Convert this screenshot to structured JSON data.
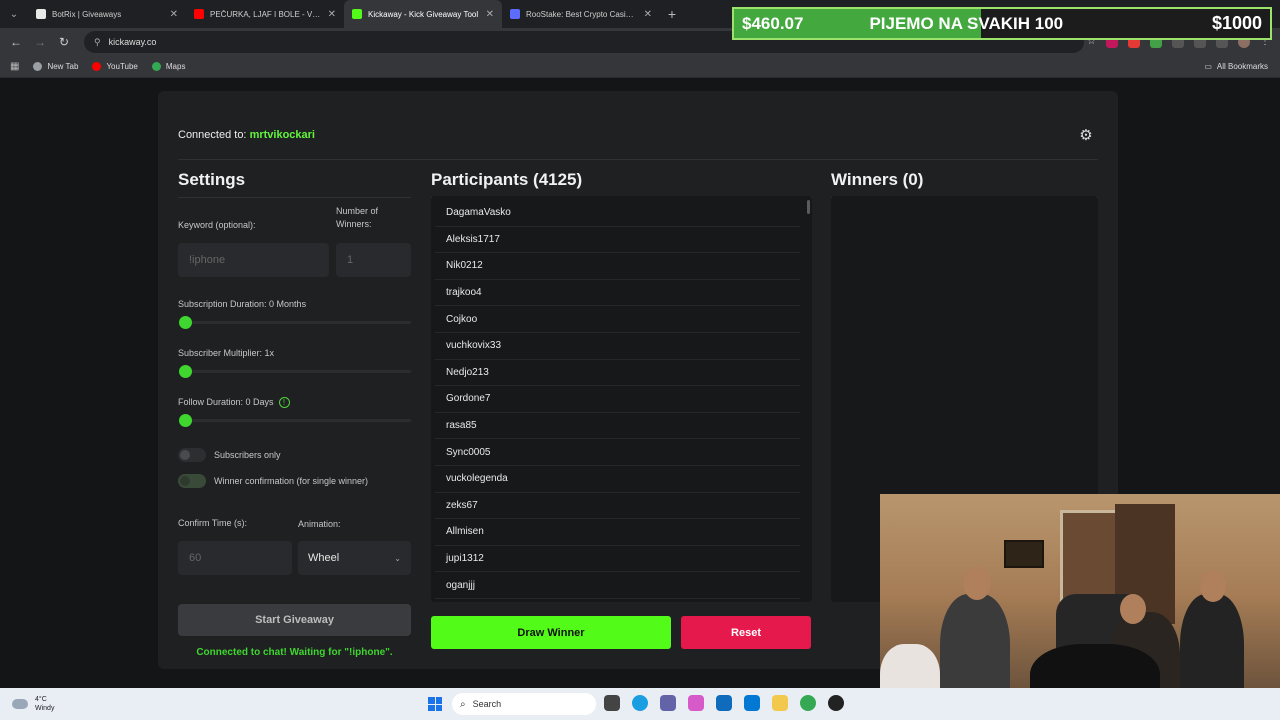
{
  "browser": {
    "tabs": [
      {
        "label": "BotRix | Giveaways",
        "color": "#e8e8e8",
        "active": false
      },
      {
        "label": "PEČURKA, LJAF I BOLE - VOSTOK",
        "color": "#ff0000",
        "active": false
      },
      {
        "label": "Kickaway - Kick Giveaway Tool",
        "color": "#53fc18",
        "active": true
      },
      {
        "label": "RooStake: Best Crypto Casino &",
        "color": "#5b6cff",
        "active": false
      }
    ],
    "url": "kickaway.co",
    "bookmarks": [
      {
        "label": "New Tab",
        "color": "#9aa0a6"
      },
      {
        "label": "YouTube",
        "color": "#ff0000"
      },
      {
        "label": "Maps",
        "color": "#34a853"
      }
    ],
    "all_bookmarks": "All Bookmarks"
  },
  "overlay": {
    "amount": "$460.07",
    "title": "PIJEMO NA SVAKIH 100",
    "goal": "$1000",
    "progress": 0.4601
  },
  "app": {
    "connected_prefix": "Connected to:",
    "channel": "mrtvikockari",
    "settings": {
      "title": "Settings",
      "keyword_label": "Keyword (optional):",
      "keyword_placeholder": "!iphone",
      "winners_label": "Number of Winners:",
      "winners_placeholder": "1",
      "sub_duration_label": "Subscription Duration: 0 Months",
      "sub_multiplier_label": "Subscriber Multiplier: 1x",
      "follow_duration_label": "Follow Duration: 0 Days",
      "subscribers_only_label": "Subscribers only",
      "winner_confirmation_label": "Winner confirmation (for single winner)",
      "confirm_time_label": "Confirm Time (s):",
      "confirm_time_placeholder": "60",
      "animation_label": "Animation:",
      "animation_value": "Wheel",
      "start_label": "Start Giveaway",
      "status": "Connected to chat! Waiting for \"!iphone\"."
    },
    "participants": {
      "title": "Participants (4125)",
      "names": [
        "DagamaVasko",
        "Aleksis1717",
        "Nik0212",
        "trajkoo4",
        "Cojkoo",
        "vuchkovix33",
        "Nedjo213",
        "Gordone7",
        "rasa85",
        "Sync0005",
        "vuckolegenda",
        "zeks67",
        "Allmisen",
        "jupi1312",
        "oganjjj"
      ]
    },
    "winners": {
      "title": "Winners (0)"
    },
    "draw_label": "Draw Winner",
    "reset_label": "Reset"
  },
  "taskbar": {
    "temp": "4°C",
    "weather": "Windy",
    "search": "Search"
  }
}
